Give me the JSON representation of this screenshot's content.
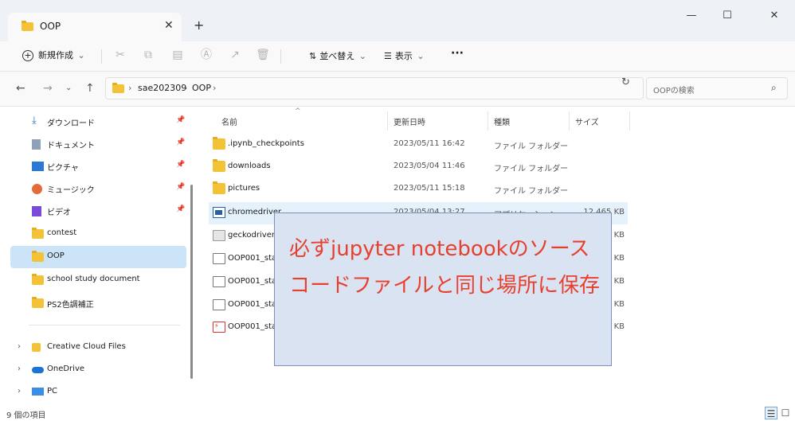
{
  "window": {
    "tab_title": "OOP",
    "tab_close": "✕",
    "new_tab": "+",
    "minimize": "—",
    "maximize": "☐",
    "close": "✕"
  },
  "toolbar": {
    "new_label": "新規作成",
    "new_chevron": "⌄",
    "sort_label": "並べ替え",
    "sort_chevron": "⌄",
    "view_label": "表示",
    "view_chevron": "⌄",
    "more": "···"
  },
  "address": {
    "crumbs": [
      "sae202309",
      "OOP"
    ],
    "separator": "›",
    "search_placeholder": "OOPの検索"
  },
  "nav": {
    "quick": [
      {
        "label": "ダウンロード",
        "icon": "download-icon",
        "color": "#2b78c6"
      },
      {
        "label": "ドキュメント",
        "icon": "document-icon",
        "color": "#8da2b8"
      },
      {
        "label": "ピクチャ",
        "icon": "pictures-icon",
        "color": "#2a78d8"
      },
      {
        "label": "ミュージック",
        "icon": "music-icon",
        "color": "#e36b3a"
      },
      {
        "label": "ビデオ",
        "icon": "video-icon",
        "color": "#7a4bd8"
      },
      {
        "label": "contest",
        "icon": "folder-icon"
      },
      {
        "label": "OOP",
        "icon": "folder-icon"
      },
      {
        "label": "school study document",
        "icon": "folder-icon"
      },
      {
        "label": "PS2色調補正",
        "icon": "folder-icon"
      }
    ],
    "groups": [
      {
        "label": "Creative Cloud Files",
        "icon": "creative-cloud-icon"
      },
      {
        "label": "OneDrive",
        "icon": "onedrive-icon"
      },
      {
        "label": "PC",
        "icon": "pc-icon"
      }
    ]
  },
  "columns": {
    "name": "名前",
    "date": "更新日時",
    "type": "種類",
    "size": "サイズ",
    "sort_caret": "^"
  },
  "files": [
    {
      "name": ".ipynb_checkpoints",
      "date": "2023/05/11 16:42",
      "type": "ファイル フォルダー",
      "size": "",
      "icon": "folder"
    },
    {
      "name": "downloads",
      "date": "2023/05/04 11:46",
      "type": "ファイル フォルダー",
      "size": "",
      "icon": "folder"
    },
    {
      "name": "pictures",
      "date": "2023/05/11 15:18",
      "type": "ファイル フォルダー",
      "size": "",
      "icon": "folder"
    },
    {
      "name": "chromedriver",
      "date": "2023/05/04 13:27",
      "type": "アプリケーション",
      "size": "12,465 KB",
      "icon": "app"
    },
    {
      "name": "geckodriver",
      "date": "",
      "type": "",
      "size": "0 KB",
      "icon": "txt"
    },
    {
      "name": "OOP001_star",
      "date": "",
      "type": "",
      "size": "3 KB",
      "icon": "doc"
    },
    {
      "name": "OOP001_star",
      "date": "",
      "type": "",
      "size": "0 KB",
      "icon": "doc"
    },
    {
      "name": "OOP001_star",
      "date": "",
      "type": "",
      "size": "0 KB",
      "icon": "doc"
    },
    {
      "name": "OOP001_star",
      "date": "",
      "type": "",
      "size": "0 KB",
      "icon": "pdf"
    }
  ],
  "annotation": {
    "text": "必ずjupyter notebookのソースコードファイルと同じ場所に保存"
  },
  "status": {
    "item_count": "9 個の項目"
  }
}
